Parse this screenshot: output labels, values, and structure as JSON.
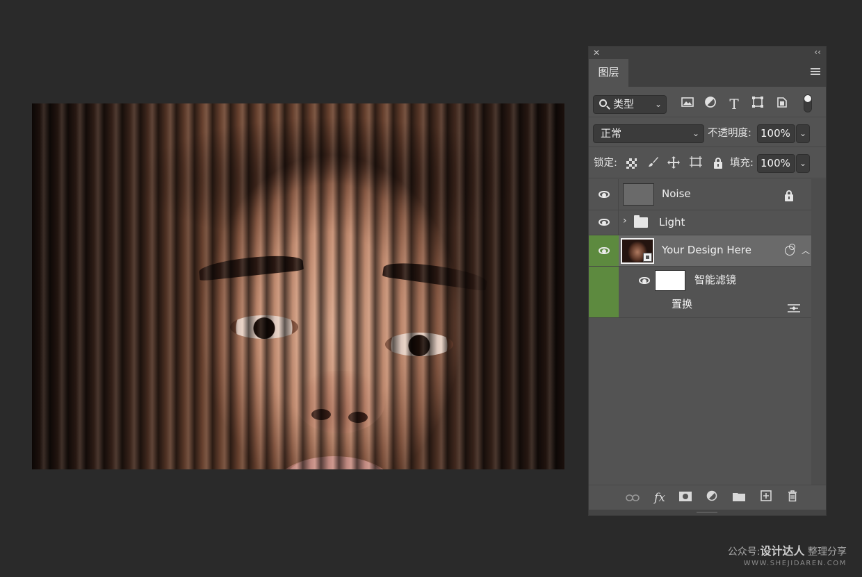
{
  "canvas": {
    "description_icon": "portrait-with-stripes"
  },
  "panel": {
    "close_glyph": "✕",
    "collapse_glyph": "‹‹",
    "tab_label": "图层",
    "filter": {
      "label": "类型",
      "icons": [
        "image-filter-icon",
        "adjustment-filter-icon",
        "type-filter-icon",
        "shape-filter-icon",
        "smart-object-filter-icon"
      ]
    },
    "blend_mode": "正常",
    "opacity_label": "不透明度:",
    "opacity_value": "100%",
    "lock_label": "锁定:",
    "fill_label": "填充:",
    "fill_value": "100%",
    "layers": [
      {
        "name": "Noise",
        "visible": true,
        "locked": true
      },
      {
        "name": "Light",
        "visible": true,
        "type": "group"
      },
      {
        "name": "Your Design Here",
        "visible": true,
        "selected": true,
        "type": "smart-object"
      }
    ],
    "smart_filters_label": "智能滤镜",
    "filter_item_label": "置换",
    "selected_color": "#5d8a3f"
  },
  "watermark": {
    "prefix": "公众号:",
    "brand": "设计达人",
    "suffix": "整理分享",
    "url": "WWW.SHEJIDAREN.COM"
  }
}
